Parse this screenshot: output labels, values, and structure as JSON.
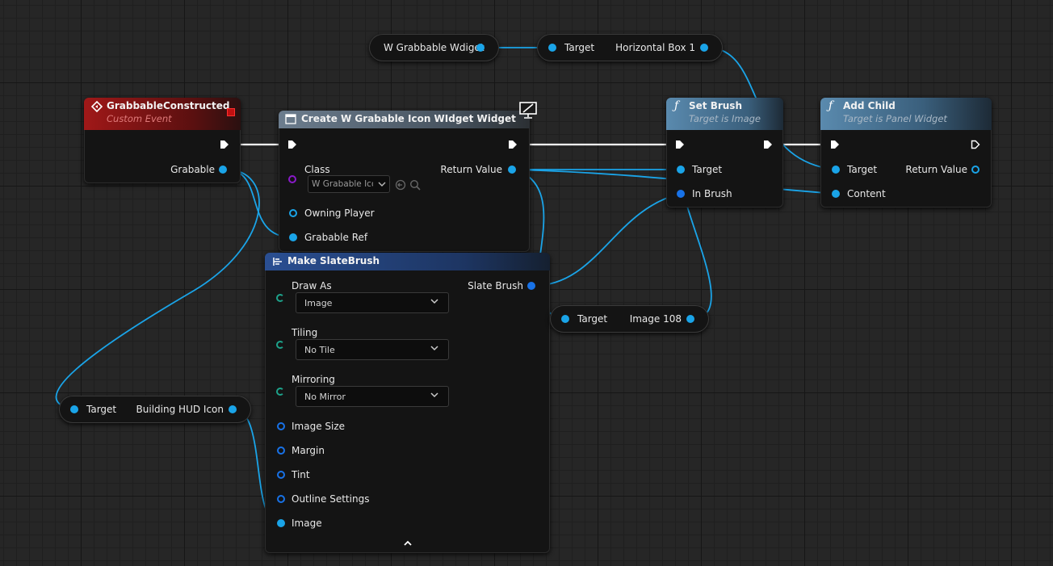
{
  "colors": {
    "event_header": "#8a1414",
    "function_header": "#3e5e78",
    "widget_header": "#5a6b7d",
    "slatebrush_header": "#1f3d72",
    "wire": "#1aa4e8",
    "exec": "#ffffff"
  },
  "nodes": {
    "grabbable_constructed": {
      "title": "GrabbableConstructed",
      "subtitle": "Custom Event",
      "out_pin": "Grabable"
    },
    "create_widget": {
      "title": "Create W Grabable Icon WIdget Widget",
      "class_label": "Class",
      "class_value": "W Grabable Icoi",
      "owning_player": "Owning Player",
      "grabable_ref": "Grabable Ref",
      "return_value": "Return Value"
    },
    "set_brush": {
      "title": "Set Brush",
      "subtitle": "Target is Image",
      "target": "Target",
      "in_brush": "In Brush"
    },
    "add_child": {
      "title": "Add Child",
      "subtitle": "Target is Panel Widget",
      "target": "Target",
      "content": "Content",
      "return_value": "Return Value"
    },
    "make_slate_brush": {
      "title": "Make SlateBrush",
      "slate_brush": "Slate Brush",
      "draw_as": "Draw As",
      "draw_as_value": "Image",
      "tiling": "Tiling",
      "tiling_value": "No Tile",
      "mirroring": "Mirroring",
      "mirroring_value": "No Mirror",
      "image_size": "Image Size",
      "margin": "Margin",
      "tint": "Tint",
      "outline_settings": "Outline Settings",
      "image": "Image"
    },
    "w_grabbable_widget": {
      "label": "W Grabbable Wdiget"
    },
    "horizontal_box": {
      "target": "Target",
      "label": "Horizontal Box 1"
    },
    "image_108": {
      "target": "Target",
      "label": "Image 108"
    },
    "building_hud_icon": {
      "target": "Target",
      "label": "Building HUD Icon"
    }
  },
  "icons": [
    "event-diamond-icon",
    "widget-class-icon",
    "function-f-icon",
    "make-struct-icon",
    "network-monitor-icon",
    "collapse-arrow-icon",
    "dropdown-chevron-icon",
    "browse-arrow-icon",
    "search-icon"
  ]
}
